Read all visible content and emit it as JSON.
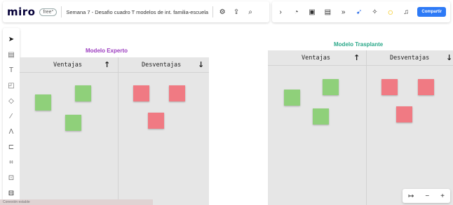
{
  "header": {
    "logo": "miro",
    "plan_badge": "free°",
    "board_title": "Semana 7 - Desafio cuadro T modelos de int. familia-escuela",
    "icons": [
      "settings-icon",
      "export-icon",
      "search-icon"
    ]
  },
  "right_toolbar": {
    "icons": [
      "chevron-right-icon",
      "timer-icon",
      "present-icon",
      "frames-icon",
      "more-icon",
      "cursor-icon",
      "reactions-icon",
      "avatar-icon",
      "bell-icon"
    ],
    "share_label": "Compartir",
    "colors": {
      "share": "#2d7af6",
      "avatar": "#f5c400"
    }
  },
  "left_tools": {
    "items": [
      "select-icon",
      "template-icon",
      "text-icon",
      "sticky-note-icon",
      "shapes-icon",
      "pen-icon",
      "comment-icon",
      "frame-icon",
      "grid-icon",
      "upload-icon"
    ],
    "bottom": "board-panel-icon"
  },
  "frames": [
    {
      "title": "Modelo Experto",
      "title_color": "#9b3bbf",
      "col1": "Ventajas",
      "col2": "Desventajas",
      "arrow1": "↑",
      "arrow2": "↓"
    },
    {
      "title": "Modelo Trasplante",
      "title_color": "#2aa889",
      "col1": "Ventajas",
      "col2": "Desventajas",
      "arrow1": "↑",
      "arrow2": "↓"
    }
  ],
  "notes": {
    "colors": {
      "green": "#8fd07a",
      "red": "#f07a83"
    }
  },
  "zoom": {
    "fit": "↦",
    "minus": "−",
    "plus": "+"
  },
  "status": "Conexión estable"
}
